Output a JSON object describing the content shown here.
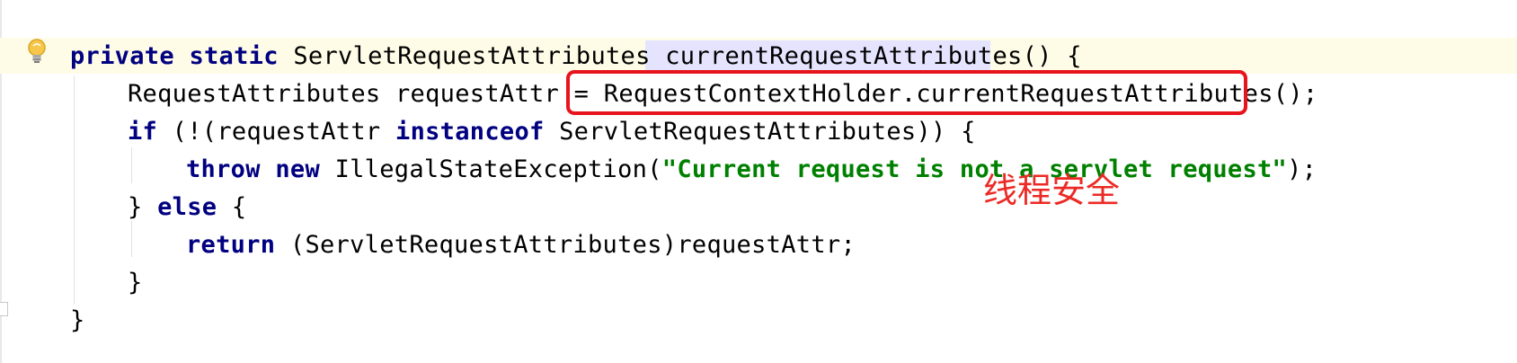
{
  "editor": {
    "lines": [
      {
        "tokens": [
          {
            "text": "private static ",
            "kind": "kw"
          },
          {
            "text": "ServletRequestAttributes ",
            "kind": "plain"
          },
          {
            "text": "currentRequestAttributes",
            "kind": "plain"
          },
          {
            "text": "() {",
            "kind": "plain"
          }
        ]
      },
      {
        "tokens": [
          {
            "text": "RequestAttributes requestAttr = RequestContextHolder.currentRequestAttributes();",
            "kind": "plain"
          }
        ]
      },
      {
        "tokens": [
          {
            "text": "if ",
            "kind": "kw"
          },
          {
            "text": "(!(requestAttr ",
            "kind": "plain"
          },
          {
            "text": "instanceof ",
            "kind": "kw"
          },
          {
            "text": "ServletRequestAttributes)) {",
            "kind": "plain"
          }
        ]
      },
      {
        "tokens": [
          {
            "text": "throw new ",
            "kind": "kw"
          },
          {
            "text": "IllegalStateException(",
            "kind": "plain"
          },
          {
            "text": "\"Current request is not a servlet request\"",
            "kind": "str"
          },
          {
            "text": ");",
            "kind": "plain"
          }
        ]
      },
      {
        "tokens": [
          {
            "text": "} ",
            "kind": "plain"
          },
          {
            "text": "else ",
            "kind": "kw"
          },
          {
            "text": "{",
            "kind": "plain"
          }
        ]
      },
      {
        "tokens": [
          {
            "text": "return ",
            "kind": "kw"
          },
          {
            "text": "(ServletRequestAttributes)requestAttr;",
            "kind": "plain"
          }
        ]
      },
      {
        "tokens": [
          {
            "text": "}",
            "kind": "plain"
          }
        ]
      },
      {
        "tokens": [
          {
            "text": "}",
            "kind": "plain"
          }
        ]
      }
    ]
  },
  "annotation": {
    "text": "线程安全"
  },
  "icons": {
    "intention": "lightbulb-icon"
  },
  "colors": {
    "keyword": "#000080",
    "string": "#008000",
    "annotation": "#ec2a25",
    "current_line": "#fefbe6",
    "identifier_highlight": "#e4e4ff"
  }
}
